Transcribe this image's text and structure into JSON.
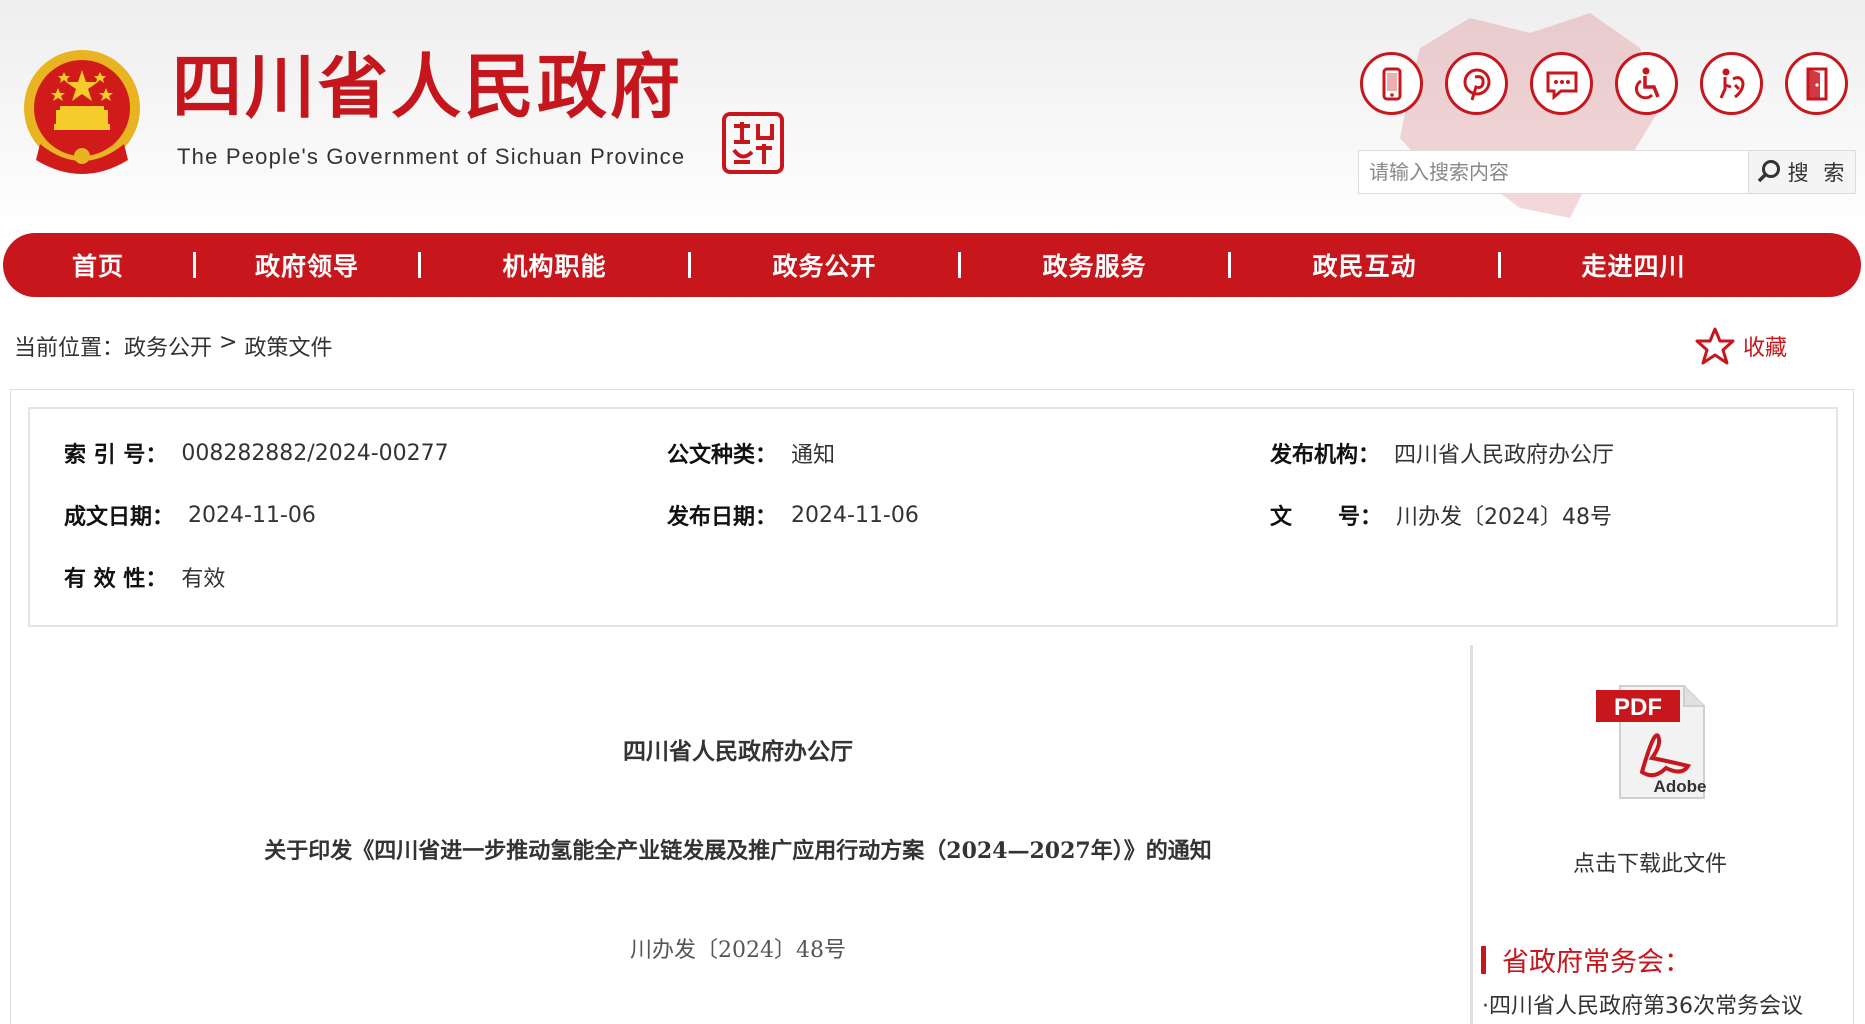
{
  "header": {
    "title": "四川省人民政府",
    "subtitle": "The People's Government of Sichuan Province",
    "emblem_icon": "national-emblem-icon",
    "seal_icon": "sichuan-seal-icon",
    "top_icons": [
      "mobile-icon",
      "pinterest-icon",
      "message-icon",
      "accessibility-icon",
      "elderly-care-icon",
      "exit-door-icon"
    ],
    "accent_color": "#c8161d"
  },
  "search": {
    "placeholder": "请输入搜索内容",
    "button_label": "搜 索"
  },
  "nav": {
    "items": [
      "首页",
      "政府领导",
      "机构职能",
      "政务公开",
      "政务服务",
      "政民互动",
      "走进四川"
    ]
  },
  "breadcrumb": {
    "prefix": "当前位置：",
    "level1": "政务公开",
    "separator": " > ",
    "level2": "政策文件"
  },
  "favorite": {
    "label": "收藏"
  },
  "meta": {
    "index_label": "索 引 号：",
    "index_value": "008282882/2024-00277",
    "doc_type_label": "公文种类：",
    "doc_type_value": "通知",
    "publisher_label": "发布机构：",
    "publisher_value": "四川省人民政府办公厅",
    "created_label": "成文日期：",
    "created_value": "2024-11-06",
    "published_label": "发布日期：",
    "published_value": "2024-11-06",
    "doc_no_label": "文      号：",
    "doc_no_value": "川办发〔2024〕48号",
    "validity_label": "有 效 性：",
    "validity_value": "有效"
  },
  "document": {
    "issuer": "四川省人民政府办公厅",
    "title": "关于印发《四川省进一步推动氢能全产业链发展及推广应用行动方案（2024—2027年）》的通知",
    "number": "川办发〔2024〕48号"
  },
  "sidebar": {
    "pdf_label_top": "PDF",
    "pdf_label_bottom": "Adobe",
    "download_label": "点击下载此文件",
    "section_heading": "省政府常务会：",
    "links": [
      "·四川省人民政府第36次常务会议"
    ]
  }
}
